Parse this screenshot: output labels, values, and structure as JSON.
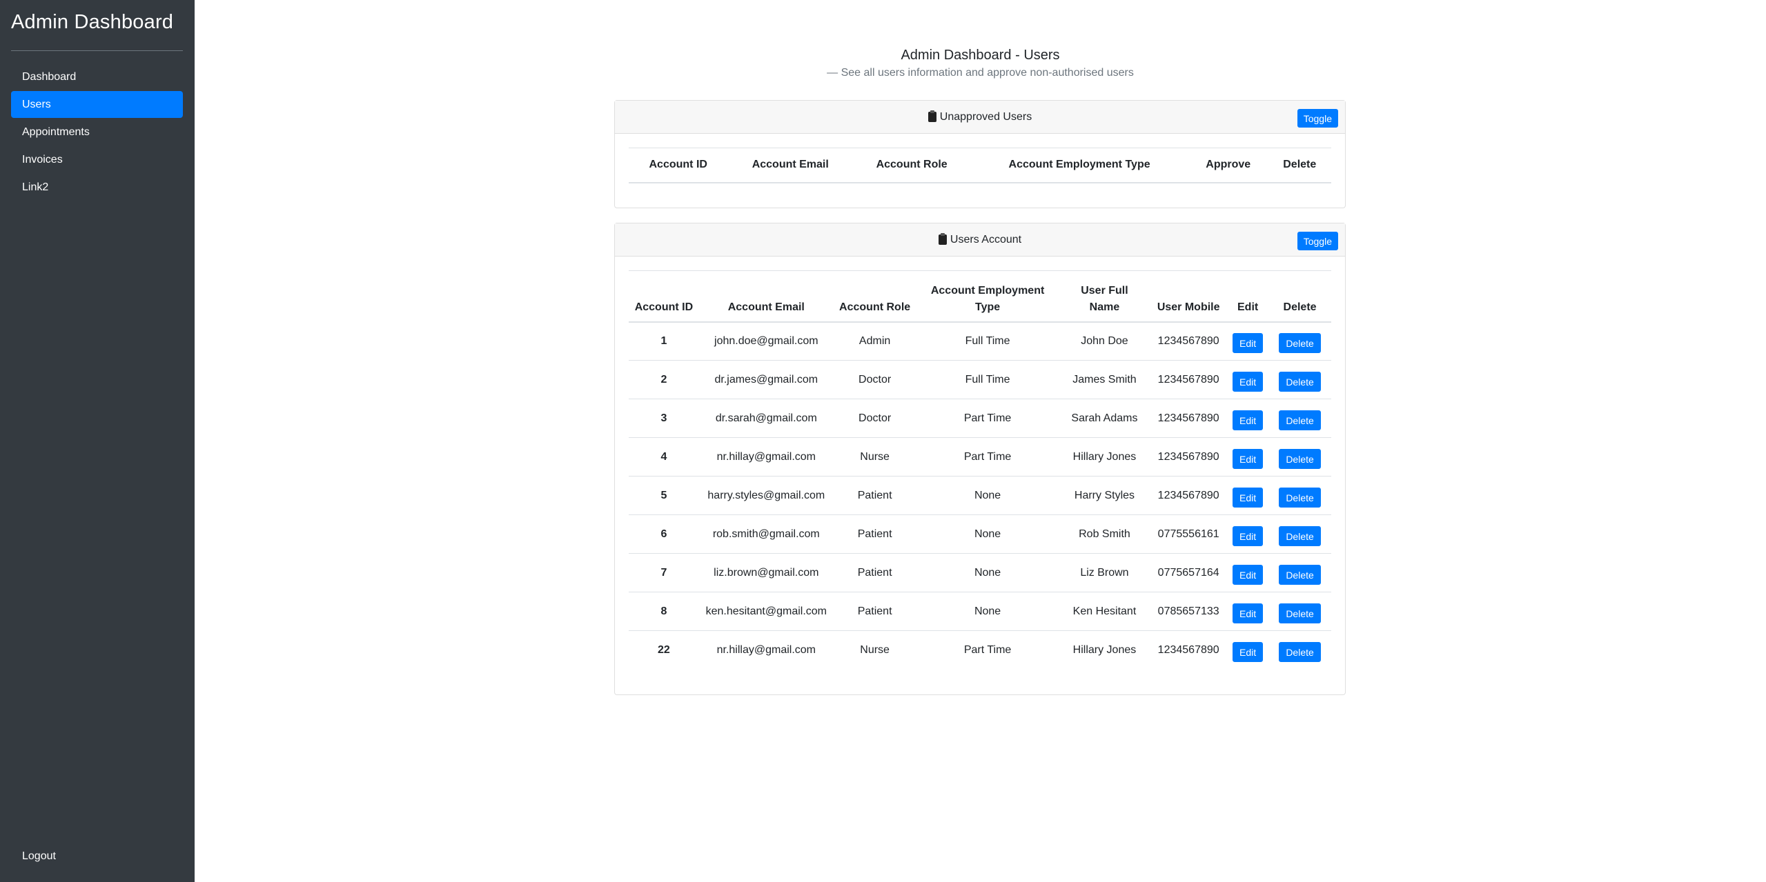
{
  "sidebar": {
    "brand": "Admin Dashboard",
    "items": [
      {
        "label": "Dashboard",
        "active": false
      },
      {
        "label": "Users",
        "active": true
      },
      {
        "label": "Appointments",
        "active": false
      },
      {
        "label": "Invoices",
        "active": false
      },
      {
        "label": "Link2",
        "active": false
      }
    ],
    "logout_label": "Logout"
  },
  "header": {
    "title": "Admin Dashboard - Users",
    "subtitle": "— See all users information and approve non-authorised users"
  },
  "unapproved": {
    "title": "Unapproved Users",
    "toggle_label": "Toggle",
    "columns": [
      "Account ID",
      "Account Email",
      "Account Role",
      "Account Employment Type",
      "Approve",
      "Delete"
    ]
  },
  "users": {
    "title": "Users Account",
    "toggle_label": "Toggle",
    "columns": [
      "Account ID",
      "Account Email",
      "Account Role",
      "Account Employment Type",
      "User Full Name",
      "User Mobile",
      "Edit",
      "Delete"
    ],
    "edit_label": "Edit",
    "delete_label": "Delete",
    "rows": [
      [
        "1",
        "john.doe@gmail.com",
        "Admin",
        "Full Time",
        "John Doe",
        "1234567890"
      ],
      [
        "2",
        "dr.james@gmail.com",
        "Doctor",
        "Full Time",
        "James Smith",
        "1234567890"
      ],
      [
        "3",
        "dr.sarah@gmail.com",
        "Doctor",
        "Part Time",
        "Sarah Adams",
        "1234567890"
      ],
      [
        "4",
        "nr.hillay@gmail.com",
        "Nurse",
        "Part Time",
        "Hillary Jones",
        "1234567890"
      ],
      [
        "5",
        "harry.styles@gmail.com",
        "Patient",
        "None",
        "Harry Styles",
        "1234567890"
      ],
      [
        "6",
        "rob.smith@gmail.com",
        "Patient",
        "None",
        "Rob Smith",
        "0775556161"
      ],
      [
        "7",
        "liz.brown@gmail.com",
        "Patient",
        "None",
        "Liz Brown",
        "0775657164"
      ],
      [
        "8",
        "ken.hesitant@gmail.com",
        "Patient",
        "None",
        "Ken Hesitant",
        "0785657133"
      ],
      [
        "22",
        "nr.hillay@gmail.com",
        "Nurse",
        "Part Time",
        "Hillary Jones",
        "1234567890"
      ]
    ]
  },
  "colors": {
    "sidebar_bg": "#343a40",
    "accent": "#007bff"
  }
}
